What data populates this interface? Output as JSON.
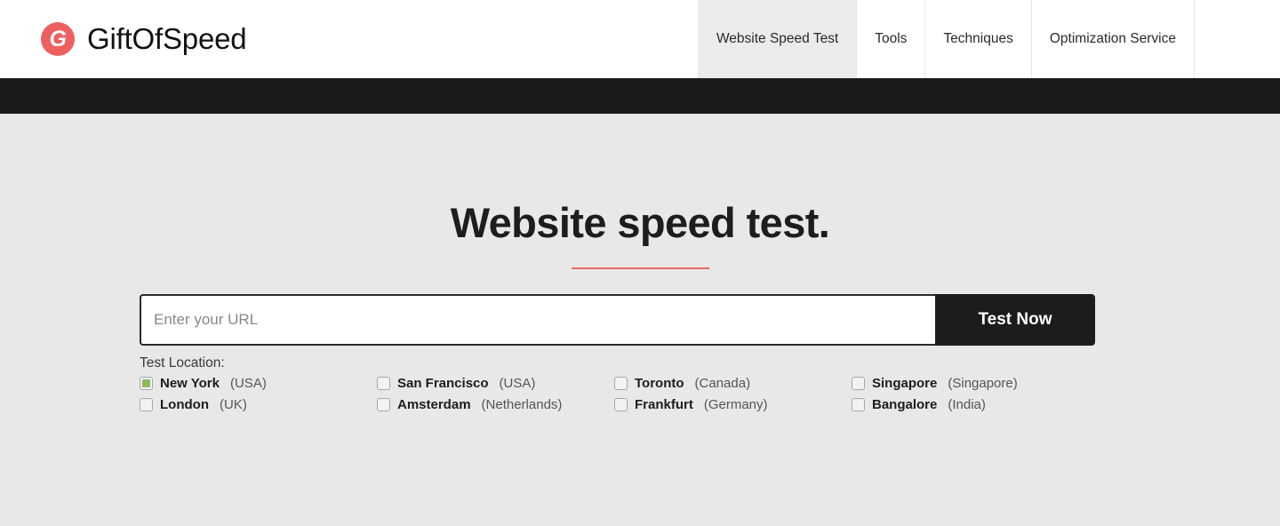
{
  "brand": {
    "mark_letter": "G",
    "name": "GiftOfSpeed",
    "mark_color": "#ee5f5f"
  },
  "nav": {
    "items": [
      {
        "label": "Website Speed Test",
        "active": true
      },
      {
        "label": "Tools",
        "active": false
      },
      {
        "label": "Techniques",
        "active": false
      },
      {
        "label": "Optimization Service",
        "active": false
      }
    ]
  },
  "hero": {
    "title": "Website speed test.",
    "rule_color": "#ed6a63"
  },
  "search": {
    "placeholder": "Enter your URL",
    "value": "",
    "button_label": "Test Now"
  },
  "locations": {
    "label": "Test Location:",
    "options": [
      {
        "city": "New York",
        "country": "(USA)",
        "checked": true
      },
      {
        "city": "San Francisco",
        "country": "(USA)",
        "checked": false
      },
      {
        "city": "Toronto",
        "country": "(Canada)",
        "checked": false
      },
      {
        "city": "Singapore",
        "country": "(Singapore)",
        "checked": false
      },
      {
        "city": "London",
        "country": "(UK)",
        "checked": false
      },
      {
        "city": "Amsterdam",
        "country": "(Netherlands)",
        "checked": false
      },
      {
        "city": "Frankfurt",
        "country": "(Germany)",
        "checked": false
      },
      {
        "city": "Bangalore",
        "country": "(India)",
        "checked": false
      }
    ],
    "checked_color": "#8bbd5a"
  }
}
